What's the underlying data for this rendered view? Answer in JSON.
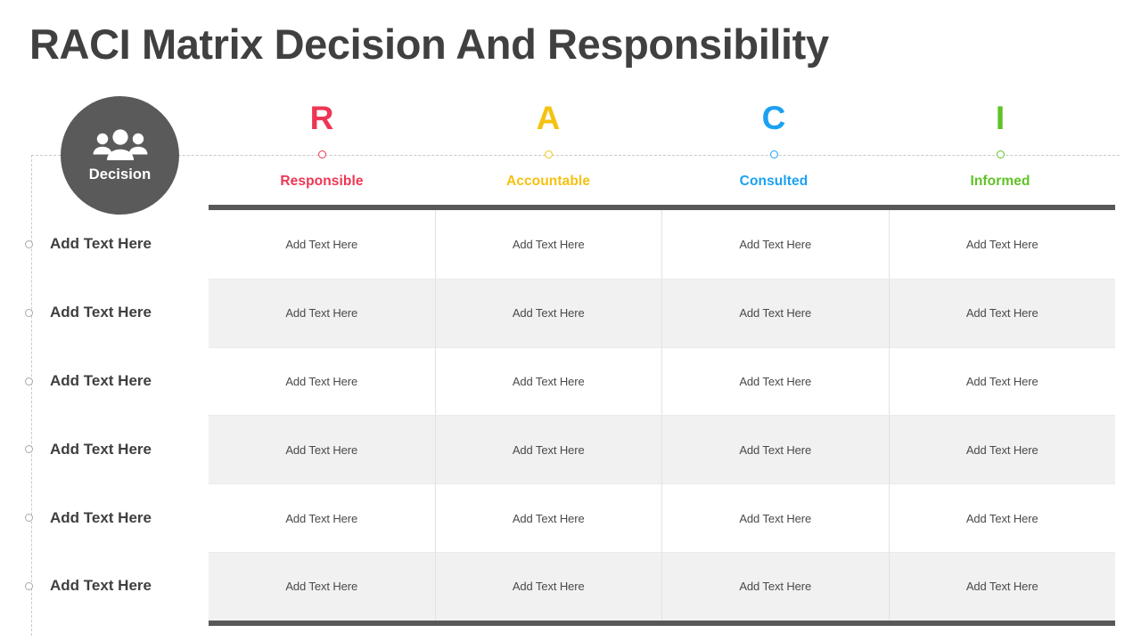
{
  "title": "RACI Matrix Decision And Responsibility",
  "badge": {
    "label": "Decision",
    "icon": "people-group-icon",
    "color": "#5a5a5a"
  },
  "columns": [
    {
      "letter": "R",
      "name": "Responsible",
      "color": "#ee3654"
    },
    {
      "letter": "A",
      "name": "Accountable",
      "color": "#f5c211"
    },
    {
      "letter": "C",
      "name": "Consulted",
      "color": "#1ba1f2"
    },
    {
      "letter": "I",
      "name": "Informed",
      "color": "#60c226"
    }
  ],
  "rows": [
    {
      "label": "Add Text Here",
      "cells": [
        "Add Text Here",
        "Add Text Here",
        "Add Text Here",
        "Add Text Here"
      ]
    },
    {
      "label": "Add Text Here",
      "cells": [
        "Add Text Here",
        "Add Text Here",
        "Add Text Here",
        "Add Text Here"
      ]
    },
    {
      "label": "Add Text Here",
      "cells": [
        "Add Text Here",
        "Add Text Here",
        "Add Text Here",
        "Add Text Here"
      ]
    },
    {
      "label": "Add Text Here",
      "cells": [
        "Add Text Here",
        "Add Text Here",
        "Add Text Here",
        "Add Text Here"
      ]
    },
    {
      "label": "Add Text Here",
      "cells": [
        "Add Text Here",
        "Add Text Here",
        "Add Text Here",
        "Add Text Here"
      ]
    },
    {
      "label": "Add Text Here",
      "cells": [
        "Add Text Here",
        "Add Text Here",
        "Add Text Here",
        "Add Text Here"
      ]
    }
  ],
  "theme": {
    "title_color": "#404040",
    "row_label_color": "#3f3f3f",
    "cell_text_color": "#4a4a4a",
    "table_border_color": "#58585a",
    "stripe_color": "#f1f1f1",
    "guide_line_color": "#c9c9c9"
  }
}
